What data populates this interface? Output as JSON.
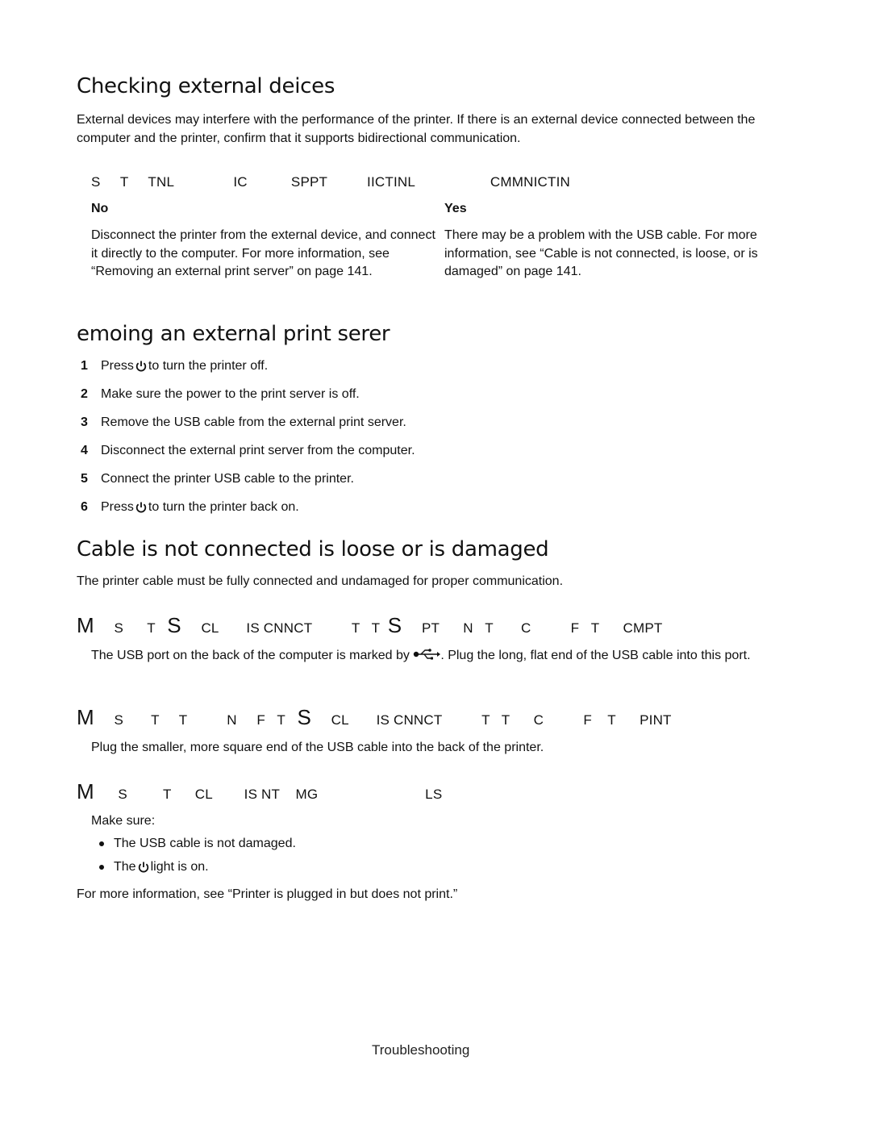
{
  "section1": {
    "title": "Checking external deices",
    "intro": "External devices may interfere with the performance of the printer. If there is an external device connected between the computer and the printer, confirm that it supports bidirectional communication.",
    "question": "S     T     TNL               IC           SPPT          IICTINL                   CMMNICTIN",
    "table": {
      "no_label": "No",
      "yes_label": "Yes",
      "no_text": "Disconnect the printer from the external device, and connect it directly to the computer. For more information, see “Removing an external print server” on page 141.",
      "yes_text": "There may be a problem with the USB cable. For more information, see “Cable is not connected, is loose, or is damaged” on page 141."
    }
  },
  "section2": {
    "title": "emoing an external print serer",
    "steps": [
      {
        "num": "1",
        "before": "Press",
        "icon": "power-icon",
        "after": "to turn the printer off."
      },
      {
        "num": "2",
        "before": "Make sure the power to the print server is off.",
        "icon": null,
        "after": ""
      },
      {
        "num": "3",
        "before": "Remove the USB cable from the external print server.",
        "icon": null,
        "after": ""
      },
      {
        "num": "4",
        "before": "Disconnect the external print server from the computer.",
        "icon": null,
        "after": ""
      },
      {
        "num": "5",
        "before": "Connect the printer USB cable to the printer.",
        "icon": null,
        "after": ""
      },
      {
        "num": "6",
        "before": "Press",
        "icon": "power-icon",
        "after": "to turn the printer back on."
      }
    ]
  },
  "section3": {
    "title": "Cable is not connected is loose or is damaged",
    "intro": "The printer cable must be fully connected and undamaged for proper communication.",
    "check1": {
      "m": "M",
      "heading_a": "     S      T   ",
      "s1": "S",
      "heading_b": "     CL       IS CNNCT          T   T  ",
      "s2": "S",
      "heading_c": "     PT      N   T       C          F   T      CMPT",
      "text_before": "The USB port on the back of the computer is marked by",
      "text_after": ". Plug the long, flat end of the USB cable into this port."
    },
    "check2": {
      "m": "M",
      "heading_a": "     S       T     T          N     F   T   ",
      "s1": "S",
      "heading_b": "     CL       IS CNNCT          T   T      C          F    T      PINT",
      "text": "Plug the smaller, more square end of the USB cable into the back of the printer."
    },
    "check3": {
      "m": "M",
      "heading": "      S         T      CL        IS NT    MG                           LS",
      "make_sure": "Make sure:",
      "bullets": [
        {
          "before": "The USB cable is not damaged.",
          "icon": null,
          "after": ""
        },
        {
          "before": "The",
          "icon": "power-icon",
          "after": "light is on."
        }
      ]
    },
    "more_info": "For more information, see “Printer is plugged in but does not print.”"
  },
  "footer": {
    "label": "Troubleshooting"
  }
}
